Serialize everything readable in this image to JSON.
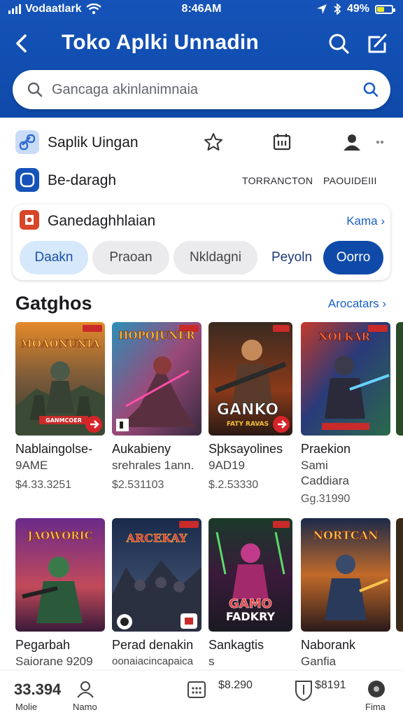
{
  "status_bar": {
    "carrier": "Vodaatlark",
    "time": "8:46AM",
    "battery": "49%",
    "battery_level": 0.49
  },
  "app_bar": {
    "title": "Toko Aplki Unnadin",
    "icons": [
      "back-arrow-icon",
      "search-icon",
      "edit-icon"
    ]
  },
  "search": {
    "placeholder": "Gancaga akinlanimnaia"
  },
  "quick_rows": [
    {
      "label": "Saplik Uingan",
      "icon": "link-icon"
    },
    {
      "label": "Be-daragh",
      "icon": "app-square-icon",
      "actions": [
        "TORRANCTON",
        "PAOUIDEIII"
      ]
    }
  ],
  "tools": [
    "star-icon",
    "calendar-icon",
    "profile-icon",
    "more-icon"
  ],
  "category_card": {
    "title": "Ganedaghhlaian",
    "link": "Kama ›",
    "chips": [
      "Daakn",
      "Praoan",
      "Nkldagni",
      "Peyoln",
      "Oorro"
    ]
  },
  "section": {
    "title": "Gatghos",
    "link": "Arocatars ›"
  },
  "games_row1": [
    {
      "name": "Nablaingolse-",
      "sub": "9AME",
      "price": "$4.33.3251",
      "cover_text": "MOAONUNIA",
      "cover_text2": "GANMCOER"
    },
    {
      "name": "Aukabieny",
      "sub": "srehrales 1ann.",
      "price": "$2.531103",
      "cover_text": "HOPOJUNER",
      "cover_text2": ""
    },
    {
      "name": "Sþksayolines",
      "sub": "9AD19",
      "price": "$.2.53330",
      "cover_text": "GANKO",
      "cover_text2": "FATY RAVAS"
    },
    {
      "name": "Praekion",
      "sub": "Sami",
      "sub2": "Caddiara",
      "price": "Gg.31990",
      "cover_text": "NOLKAR",
      "cover_text2": ""
    }
  ],
  "games_row2": [
    {
      "name": "Pegarbah",
      "sub": "Saiorane 9209",
      "cover_text": "JAOWORIC",
      "cover_text2": ""
    },
    {
      "name": "Perad denakin",
      "sub": "oonaiacincapaica",
      "cover_text": "ARCEKAY",
      "cover_text2": ""
    },
    {
      "name": "Sankagtis",
      "sub": "s",
      "cover_text": "GAMO",
      "cover_text2": "FADKRY"
    },
    {
      "name": "Naborank",
      "sub": "Ganfia",
      "cover_text": "NORTCAN",
      "cover_text2": ""
    }
  ],
  "bottom_nav": [
    {
      "label": "Molie",
      "value": "33.394",
      "icon": "grid-icon"
    },
    {
      "label": "Namo",
      "icon": "profile-icon"
    },
    {
      "value": "$8.290",
      "icon": "calendar-icon"
    },
    {
      "value": "$8191",
      "icon": "shield-icon"
    },
    {
      "label": "Fima",
      "icon": "circle-icon"
    }
  ],
  "colors": {
    "header": "#1553b9",
    "accent": "#1a5fc8",
    "chip_active": "#0f4aa9",
    "chip_light": "#d6e8fb"
  }
}
